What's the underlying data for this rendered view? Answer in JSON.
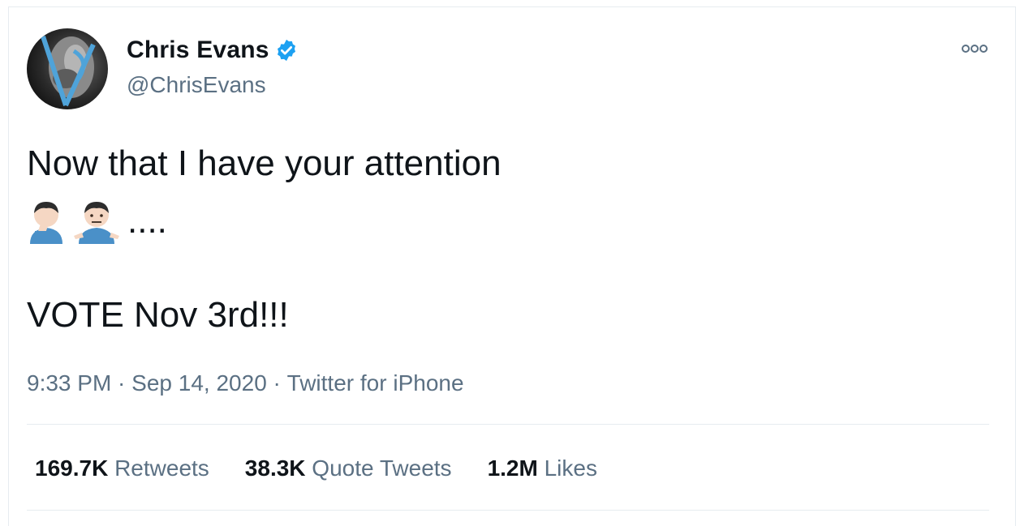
{
  "tweet": {
    "author": {
      "display_name": "Chris Evans",
      "handle": "@ChrisEvans",
      "verified": true
    },
    "text_line1": "Now that I have your attention",
    "emojis": [
      "face-palm-emoji",
      "shrug-emoji"
    ],
    "ellipsis": "....",
    "text_line2": "VOTE Nov 3rd!!!",
    "meta": {
      "time": "9:33 PM",
      "separator": " · ",
      "date": "Sep 14, 2020",
      "source": "Twitter for iPhone"
    },
    "stats": [
      {
        "count": "169.7K",
        "label": "Retweets"
      },
      {
        "count": "38.3K",
        "label": "Quote Tweets"
      },
      {
        "count": "1.2M",
        "label": "Likes"
      }
    ]
  },
  "colors": {
    "text_primary": "#0f1419",
    "text_secondary": "#5b7083",
    "verified_blue": "#1da1f2",
    "divider": "#e6ecf0"
  }
}
